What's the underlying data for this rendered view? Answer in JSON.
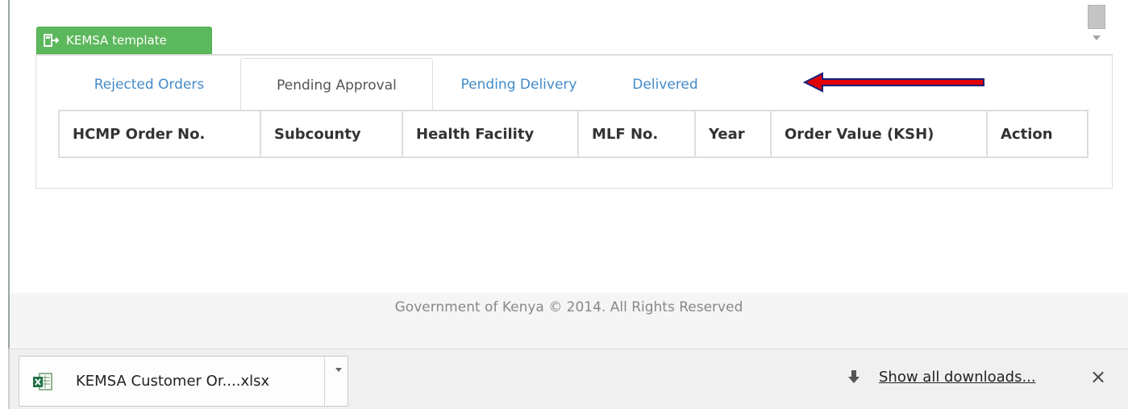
{
  "template_button": {
    "label": "KEMSA template",
    "color": "#5cb85c"
  },
  "tabs": [
    {
      "label": "Rejected Orders",
      "active": false
    },
    {
      "label": "Pending Approval",
      "active": true
    },
    {
      "label": "Pending Delivery",
      "active": false
    },
    {
      "label": "Delivered",
      "active": false
    }
  ],
  "table": {
    "headers": [
      "HCMP Order No.",
      "Subcounty",
      "Health Facility",
      "MLF No.",
      "Year",
      "Order Value (KSH)",
      "Action"
    ]
  },
  "footer": {
    "text": "Government of Kenya © 2014. All Rights Reserved"
  },
  "downloads_bar": {
    "file_name": "KEMSA Customer Or....xlsx",
    "file_icon": "excel-file-icon",
    "show_all_label": "Show all downloads...",
    "close_label": "×"
  },
  "annotation": {
    "arrow_color": "#e00000"
  },
  "colors": {
    "link": "#428bca",
    "footer_bg": "#f5f5f5"
  }
}
